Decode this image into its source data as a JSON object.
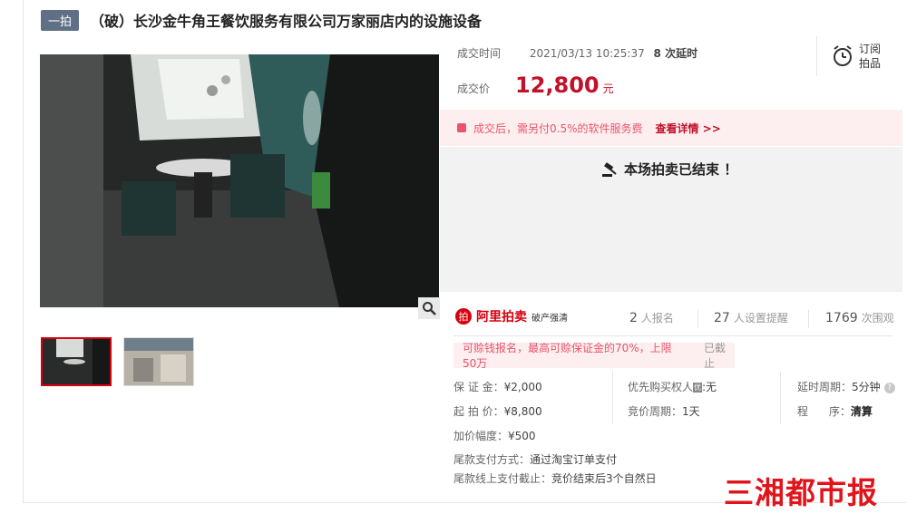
{
  "header": {
    "tag": "一拍",
    "title": "（破）长沙金牛角王餐饮服务有限公司万家丽店内的设施设备"
  },
  "deal": {
    "time_label": "成交时间",
    "time_value": "2021/03/13 10:25:37",
    "delay": "8 次延时",
    "price_label": "成交价",
    "price_value": "12,800",
    "price_unit": "元"
  },
  "subscribe": {
    "label_line1": "订阅",
    "label_line2": "拍品"
  },
  "notice": {
    "text": "成交后，需另付0.5%的软件服务费",
    "link": "查看详情 >>"
  },
  "status": {
    "ended_text": "本场拍卖已结束 ！"
  },
  "platform": {
    "brand": "阿里拍卖",
    "sub": "破产强清"
  },
  "stats": [
    {
      "num": "2",
      "unit": "人报名"
    },
    {
      "num": "27",
      "unit": "人设置提醒"
    },
    {
      "num": "1769",
      "unit": "次围观"
    }
  ],
  "pay_notice": {
    "text": "可赊钱报名，最高可赊保证金的70%，上限50万",
    "status": "已截止"
  },
  "details": {
    "deposit_label": "保 证 金：",
    "deposit_value": "¥2,000",
    "start_label": "起 拍 价：",
    "start_value": "¥8,800",
    "inc_label": "加价幅度：",
    "inc_value": "¥500",
    "priority_label": "优先购买权人",
    "priority_badge": "优",
    "priority_value": ":无",
    "cycle_label": "竞价周期：",
    "cycle_value": "1天",
    "delay_label": "延时周期：",
    "delay_value": "5分钟",
    "proc_label": "程      序：",
    "proc_value": "清算",
    "tail_method_label": "尾款支付方式：",
    "tail_method_value": "通过淘宝订单支付",
    "tail_deadline_label": "尾款线上支付截止：",
    "tail_deadline_value": "竞价结束后3个自然日"
  },
  "watermark": "三湘都市报",
  "colors": {
    "accent": "#c2112a",
    "tag_bg": "#5f6f86",
    "notice_bg": "#fdeff0"
  },
  "icons": [
    "alarm-clock-icon",
    "gavel-icon",
    "magnifier-icon",
    "notice-icon",
    "help-icon"
  ]
}
